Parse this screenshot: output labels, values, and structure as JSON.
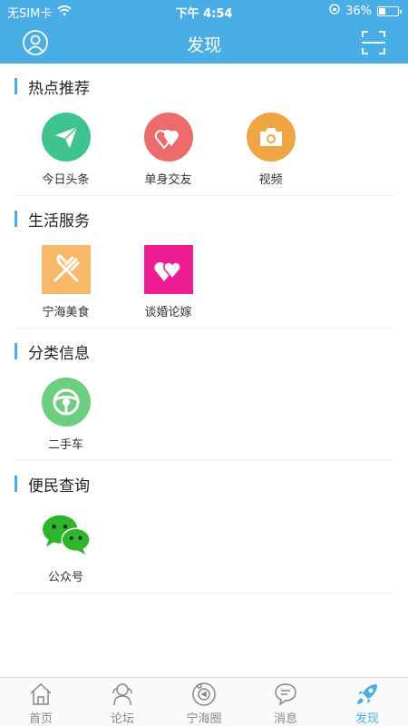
{
  "status_bar": {
    "carrier": "无SIM卡",
    "time": "下午 4:54",
    "battery": "36%",
    "battery_level": 0.36
  },
  "nav": {
    "title": "发现",
    "left_icon": "user-avatar-icon",
    "right_icon": "scan-icon"
  },
  "sections": [
    {
      "title": "热点推荐",
      "items": [
        {
          "label": "今日头条",
          "icon": "paper-plane-icon",
          "color": "#3fc48f"
        },
        {
          "label": "单身交友",
          "icon": "hearts-icon",
          "color": "#ee6b6b"
        },
        {
          "label": "视频",
          "icon": "camera-icon",
          "color": "#f0a545"
        }
      ]
    },
    {
      "title": "生活服务",
      "items": [
        {
          "label": "宁海美食",
          "icon": "fork-knife-icon",
          "color": "#f7b968"
        },
        {
          "label": "谈婚论嫁",
          "icon": "hearts-icon",
          "color": "#ef1d92"
        }
      ]
    },
    {
      "title": "分类信息",
      "items": [
        {
          "label": "二手车",
          "icon": "steering-wheel-icon",
          "color": "#6ccf80"
        }
      ]
    },
    {
      "title": "便民查询",
      "items": [
        {
          "label": "公众号",
          "icon": "wechat-icon",
          "color": "#2fb52a"
        }
      ]
    }
  ],
  "tabbar": [
    {
      "label": "首页",
      "icon": "home-icon",
      "active": false
    },
    {
      "label": "论坛",
      "icon": "forum-icon",
      "active": false
    },
    {
      "label": "宁海圈",
      "icon": "circle-icon",
      "active": false
    },
    {
      "label": "消息",
      "icon": "message-icon",
      "active": false
    },
    {
      "label": "发现",
      "icon": "rocket-icon",
      "active": true
    }
  ],
  "colors": {
    "brand": "#4aaee6",
    "inactive": "#888888"
  }
}
